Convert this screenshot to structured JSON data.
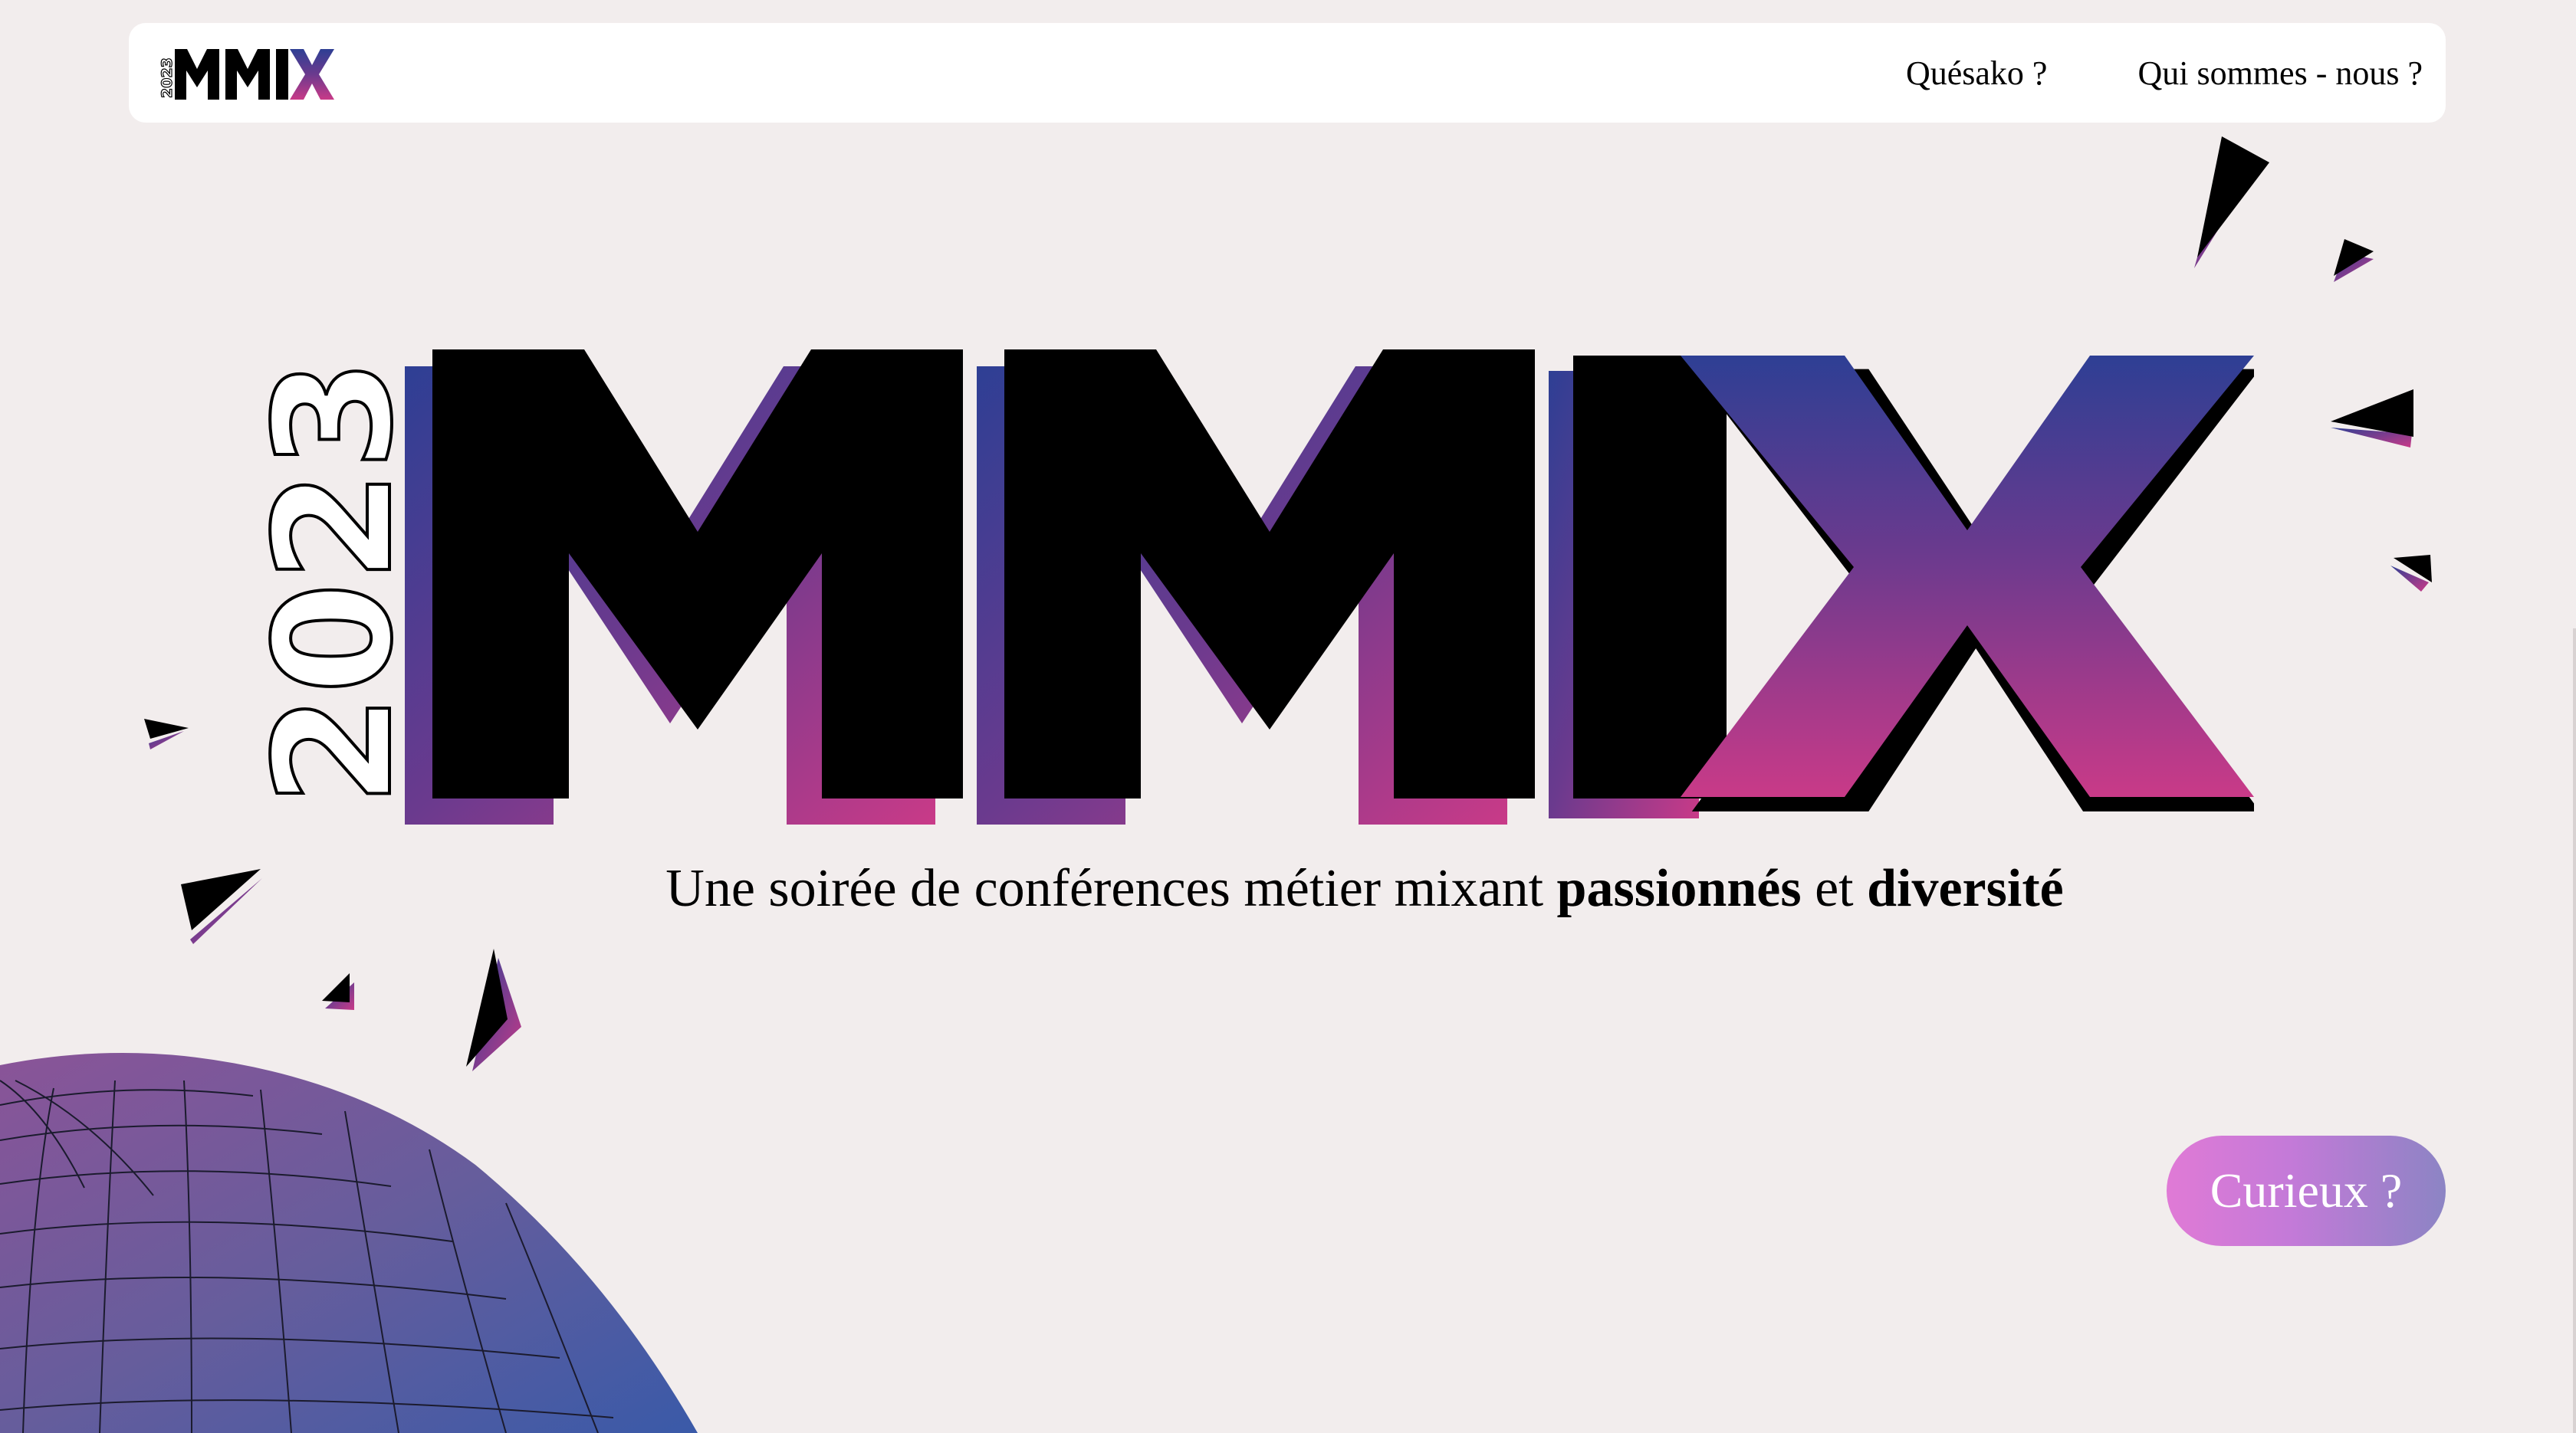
{
  "brand": {
    "year": "2023",
    "name": "MMIX"
  },
  "nav": {
    "links": [
      {
        "label": "Quésako ?"
      },
      {
        "label": "Qui sommes - nous ?"
      }
    ]
  },
  "hero": {
    "tagline_start": "Une soirée de conférences métier mixant ",
    "tagline_bold_1": "passionnés",
    "tagline_mid": " et ",
    "tagline_bold_2": "diversité"
  },
  "cta": {
    "label": "Curieux ?"
  },
  "colors": {
    "background": "#f2eded",
    "navbar": "#ffffff",
    "gradient_blue": "#2e3f94",
    "gradient_purple": "#6b3a8e",
    "gradient_pink": "#c93a88",
    "cta_pink": "#e07ad6",
    "cta_lavender": "#8c84c4",
    "text": "#000000"
  }
}
